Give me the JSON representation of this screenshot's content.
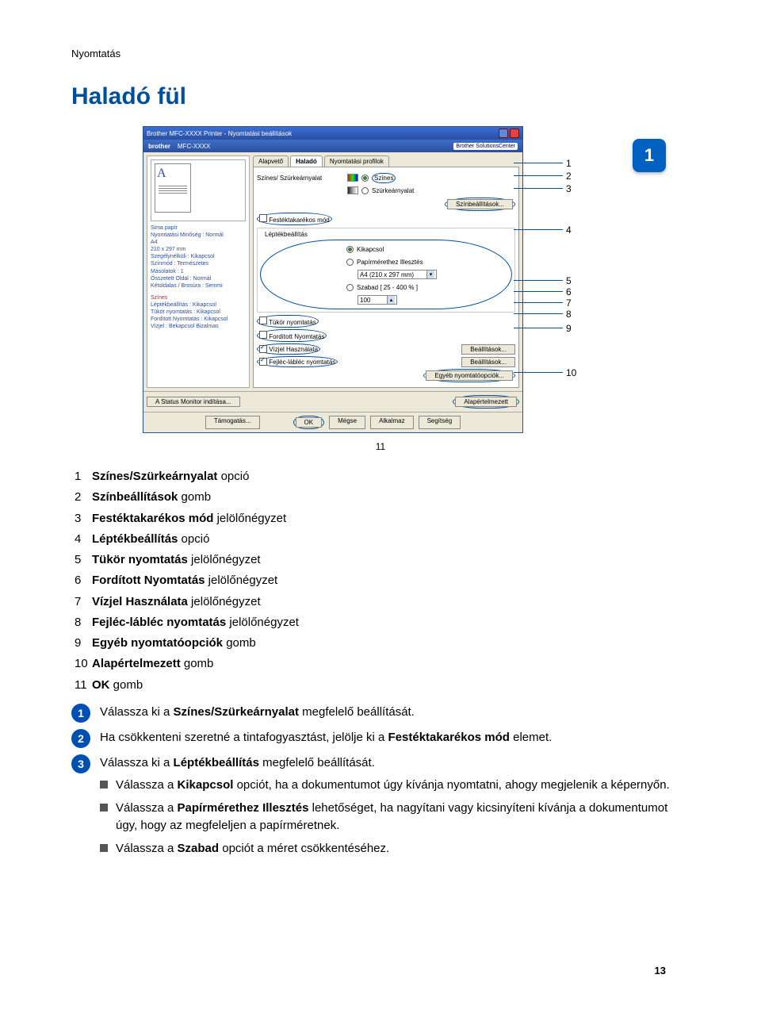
{
  "section": "Nyomtatás",
  "heading": "Haladó fül",
  "chapter": "1",
  "dialog": {
    "title": "Brother MFC-XXXX    Printer - Nyomtatási beállítások",
    "brand": "brother",
    "model": "MFC-XXXX",
    "bsc": "Brother SolutionsCenter",
    "tabs": {
      "t1": "Alapvető",
      "t2": "Haladó",
      "t3": "Nyomtatási profilok"
    },
    "left": {
      "l1": "Sima papír",
      "l2": "Nyomtatási Minőség : Normál",
      "l3": "A4",
      "l4": "210 x 297 mm",
      "l5": "Szegélynélküli : Kikapcsol",
      "l6": "Színmód : Természetes",
      "l7": "Másolatok : 1",
      "l8": "Összetett Oldal : Normál",
      "l9": "Kétoldalas / Brosúra : Semmi",
      "l10": "Színes",
      "l11": "Léptékbeállítás : Kikapcsol",
      "l12": "Tükör nyomtatás : Kikapcsol",
      "l13": "Fordított Nyomtatás : Kikapcsol",
      "l14": "Vízjel : Bekapcsol Bizalmas"
    },
    "grp_color": "Színes/ Szürkeárnyalat",
    "opt_color": "Színes",
    "opt_gray": "Szürkeárnyalat",
    "btn_colorset": "Színbeállítások...",
    "chk_toner": "Festéktakarékos mód",
    "grp_scale": "Léptékbeállítás",
    "opt_off": "Kikapcsol",
    "opt_fit": "Papírmérethez Illesztés",
    "paper": "A4 (210 x 297 mm)",
    "opt_free": "Szabad [ 25 - 400 % ]",
    "free_val": "100",
    "chk_mirror": "Tükör nyomtatás",
    "chk_reverse": "Fordított Nyomtatás",
    "chk_watermark": "Vízjel Használata",
    "btn_wmset": "Beállítások...",
    "chk_header": "Fejléc-lábléc nyomtatás",
    "btn_hfset": "Beállítások...",
    "btn_other": "Egyéb nyomtatóopciók...",
    "btn_status": "A Status Monitor indítása...",
    "btn_default": "Alapértelmezett",
    "btn_support": "Támogatás...",
    "btn_ok": "OK",
    "btn_cancel": "Mégse",
    "btn_apply": "Alkalmaz",
    "btn_help": "Segítség"
  },
  "callouts": {
    "c1": "1",
    "c2": "2",
    "c3": "3",
    "c4": "4",
    "c5": "5",
    "c6": "6",
    "c7": "7",
    "c8": "8",
    "c9": "9",
    "c10": "10",
    "c11": "11"
  },
  "legend": {
    "i1": {
      "n": "1",
      "b": "Színes/Szürkeárnyalat",
      "s": " opció"
    },
    "i2": {
      "n": "2",
      "b": "Színbeállítások",
      "s": " gomb"
    },
    "i3": {
      "n": "3",
      "b": "Festéktakarékos mód",
      "s": " jelölőnégyzet"
    },
    "i4": {
      "n": "4",
      "b": "Léptékbeállítás",
      "s": " opció"
    },
    "i5": {
      "n": "5",
      "b": "Tükör nyomtatás",
      "s": " jelölőnégyzet"
    },
    "i6": {
      "n": "6",
      "b": "Fordított Nyomtatás",
      "s": " jelölőnégyzet"
    },
    "i7": {
      "n": "7",
      "b": "Vízjel Használata",
      "s": " jelölőnégyzet"
    },
    "i8": {
      "n": "8",
      "b": "Fejléc-lábléc nyomtatás",
      "s": " jelölőnégyzet"
    },
    "i9": {
      "n": "9",
      "b": "Egyéb nyomtatóopciók",
      "s": " gomb"
    },
    "i10": {
      "n": "10",
      "b": "Alapértelmezett",
      "s": " gomb"
    },
    "i11": {
      "n": "11",
      "b": "OK",
      "s": " gomb"
    }
  },
  "steps": {
    "s1": {
      "num": "1",
      "pre": "Válassza ki a ",
      "b": "Színes/Szürkeárnyalat",
      "post": " megfelelő beállítását."
    },
    "s2": {
      "num": "2",
      "pre": "Ha csökkenteni szeretné a tintafogyasztást, jelölje ki a ",
      "b": "Festéktakarékos mód",
      "post": " elemet."
    },
    "s3": {
      "num": "3",
      "pre": "Válassza ki a ",
      "b": "Léptékbeállítás",
      "post": " megfelelő beállítását."
    },
    "b1": {
      "pre": "Válassza a ",
      "b": "Kikapcsol",
      "post": " opciót, ha a dokumentumot úgy kívánja nyomtatni, ahogy megjelenik a képernyőn."
    },
    "b2": {
      "pre": "Válassza a ",
      "b": "Papírmérethez Illesztés",
      "post": " lehetőséget, ha nagyítani vagy kicsinyíteni kívánja a dokumentumot úgy, hogy az megfeleljen a papírméretnek."
    },
    "b3": {
      "pre": "Válassza a ",
      "b": "Szabad",
      "post": " opciót a méret csökkentéséhez."
    }
  },
  "pagenum": "13"
}
